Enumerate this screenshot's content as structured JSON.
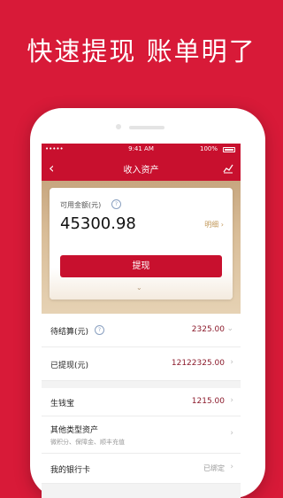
{
  "promo": {
    "title": "快速提现 账单明了"
  },
  "status_bar": {
    "carrier": "•••••",
    "time": "9:41 AM",
    "battery": "100%"
  },
  "nav": {
    "back": "‹",
    "title": "收入资产",
    "right_icon": "chart-icon"
  },
  "balance_card": {
    "label": "可用金额(元)",
    "help": "?",
    "value": "45300.98",
    "detail_link": "明细 ›",
    "withdraw_button": "提现",
    "expand": "⌄"
  },
  "rows": [
    {
      "label": "待结算(元)",
      "value": "2325.00",
      "arrow": "⌄",
      "help": "?"
    },
    {
      "label": "已提现(元)",
      "value": "12122325.00",
      "arrow": "›"
    },
    {
      "label": "生钱宝",
      "value": "1215.00",
      "arrow": "›"
    },
    {
      "label": "其他类型资产",
      "sub": "微积分、保障金、顺丰充值",
      "arrow": "›"
    },
    {
      "label": "我的银行卡",
      "value": "已绑定",
      "arrow": "›"
    }
  ],
  "colors": {
    "brand_red": "#c8102e",
    "background": "#d81a38",
    "gold": "#c39a5c"
  }
}
